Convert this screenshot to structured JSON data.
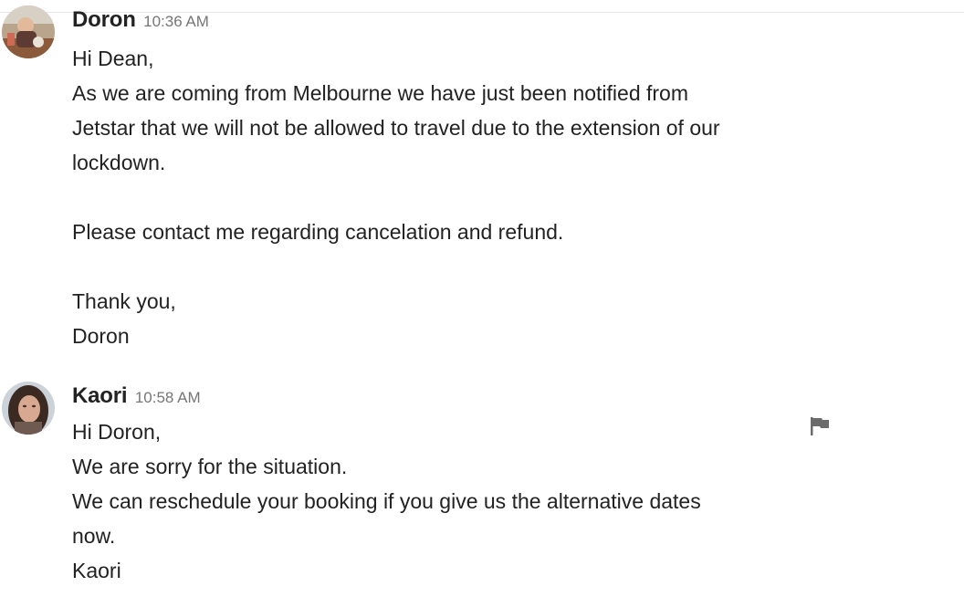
{
  "messages": [
    {
      "sender": "Doron",
      "time": "10:36 AM",
      "avatar_icon": "user-photo-doron",
      "lines": [
        "Hi Dean,",
        "As we are coming from Melbourne we have just been notified from",
        "Jetstar that we will not be allowed to travel due to the extension of our",
        "lockdown.",
        "",
        "Please contact me regarding cancelation and refund.",
        "",
        "Thank you,",
        "Doron"
      ]
    },
    {
      "sender": "Kaori",
      "time": "10:58 AM",
      "avatar_icon": "user-photo-kaori",
      "report_icon": "flag-icon",
      "lines": [
        "Hi Doron,",
        "We are sorry for the situation.",
        "We can reschedule your booking if you give us the alternative dates",
        "now.",
        "Kaori"
      ]
    }
  ],
  "colors": {
    "text": "#222222",
    "timestamp": "#767676",
    "flag": "#6b6b6b",
    "divider": "#e6e6e6"
  }
}
